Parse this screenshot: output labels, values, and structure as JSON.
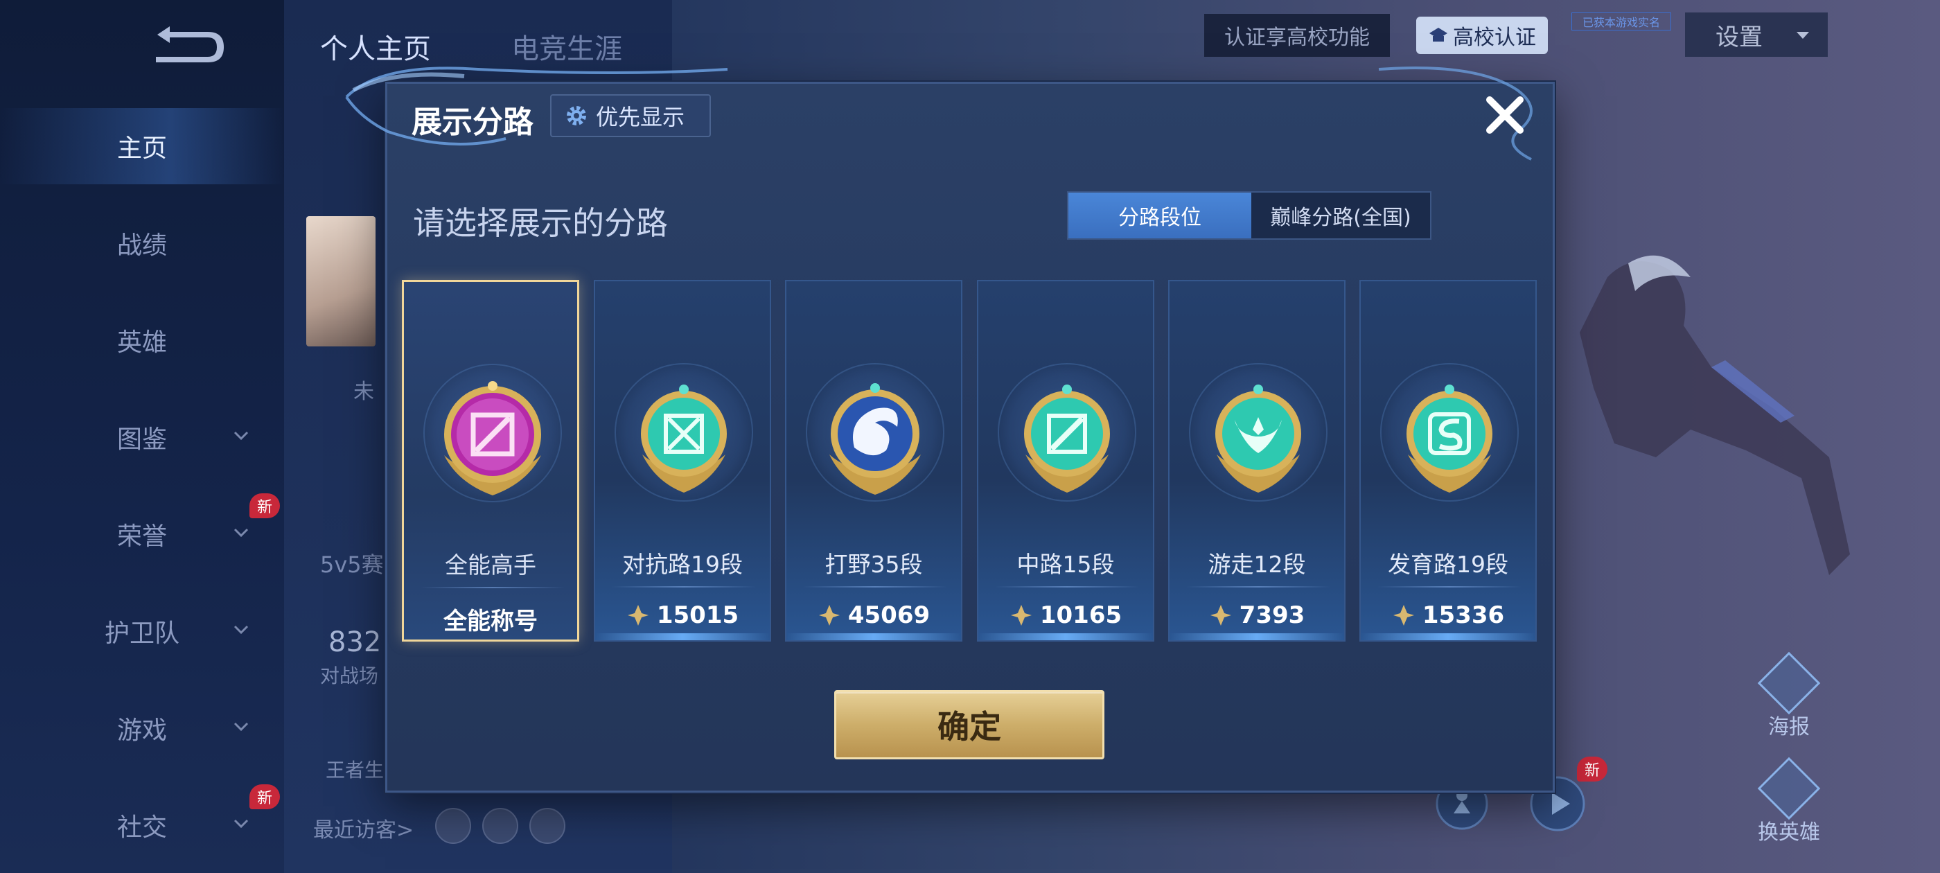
{
  "sidebar": {
    "items": [
      {
        "label": "主页",
        "active": true
      },
      {
        "label": "战绩"
      },
      {
        "label": "英雄"
      },
      {
        "label": "图鉴",
        "expandable": true
      },
      {
        "label": "荣誉",
        "expandable": true,
        "badge": "新"
      },
      {
        "label": "护卫队",
        "expandable": true
      },
      {
        "label": "游戏",
        "expandable": true
      },
      {
        "label": "社交",
        "expandable": true,
        "badge": "新"
      }
    ]
  },
  "profile": {
    "tabs": [
      {
        "label": "个人主页",
        "active": true
      },
      {
        "label": "电竞生涯"
      }
    ],
    "partial_texts": {
      "tag": "未",
      "mode": "5v5赛",
      "count": "832",
      "battle_label": "对战场",
      "king_label": "王者生"
    },
    "recent_visitors_label": "最近访客>"
  },
  "topbar": {
    "certify_tip": "认证享高校功能",
    "certify_button": "高校认证",
    "small_tag": "已获本游戏实名",
    "settings": "设置"
  },
  "right_buttons": {
    "poster": "海报",
    "change_hero": "换英雄",
    "new_badge": "新"
  },
  "modal": {
    "title": "展示分路",
    "priority_button": "优先显示",
    "subtitle": "请选择展示的分路",
    "toggle": {
      "options": [
        "分路段位",
        "巅峰分路(全国)"
      ],
      "selected": "分路段位"
    },
    "cards": [
      {
        "name": "全能高手",
        "sub": "全能称号",
        "selected": true,
        "emblem": "all-round-emblem-icon"
      },
      {
        "name": "对抗路19段",
        "score": "15015",
        "emblem": "clash-lane-emblem-icon"
      },
      {
        "name": "打野35段",
        "score": "45069",
        "emblem": "jungle-emblem-icon"
      },
      {
        "name": "中路15段",
        "score": "10165",
        "emblem": "mid-lane-emblem-icon"
      },
      {
        "name": "游走12段",
        "score": "7393",
        "emblem": "roam-emblem-icon"
      },
      {
        "name": "发育路19段",
        "score": "15336",
        "emblem": "farm-lane-emblem-icon"
      }
    ],
    "confirm": "确定"
  },
  "colors": {
    "modal_bg": "#263a60",
    "selected_border": "#f0d69a",
    "toggle_active": "#4a86d8",
    "confirm_gold": "#cdae6a",
    "emblem_purple": "#b52aa8",
    "emblem_teal": "#2ec9b0"
  }
}
